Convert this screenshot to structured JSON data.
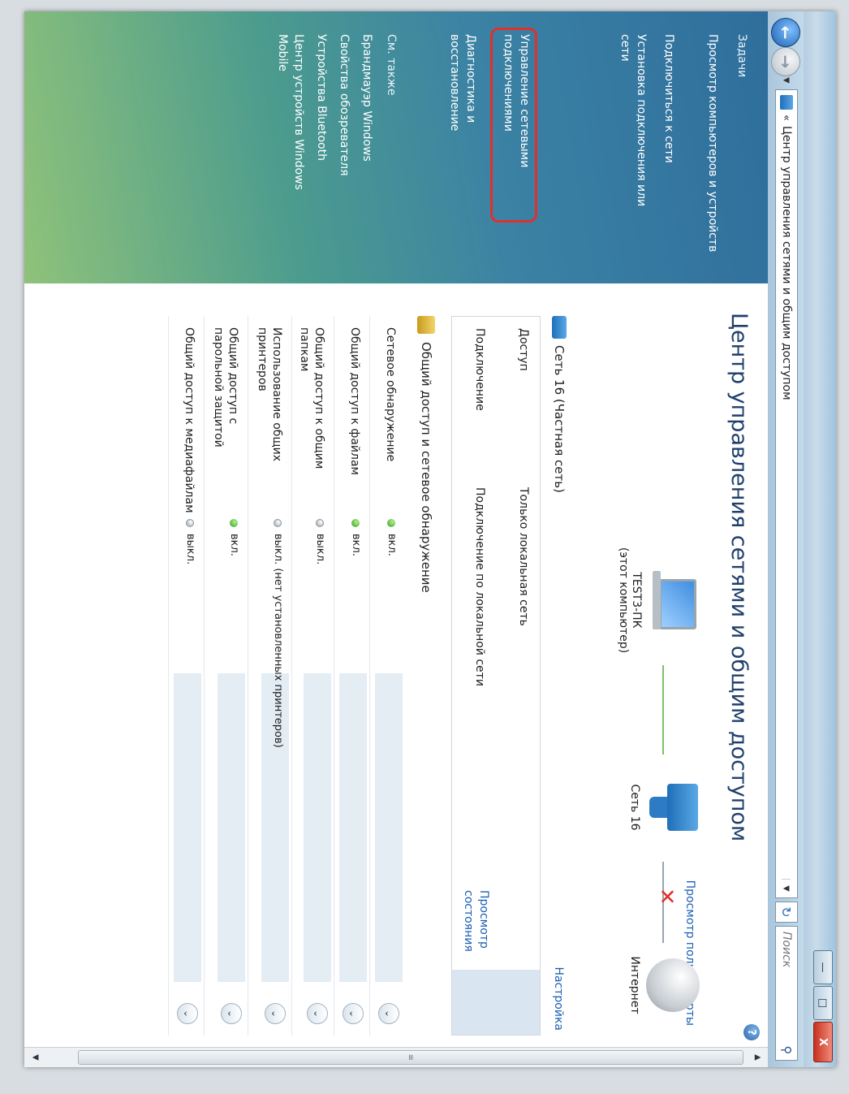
{
  "window": {
    "address_path": "Центр управления сетями и общим доступом",
    "address_chevron": "«",
    "search_placeholder": "Поиск",
    "minimize": "—",
    "maximize": "□",
    "close": "X"
  },
  "sidebar": {
    "tasks_heading": "Задачи",
    "tasks": [
      "Просмотр компьютеров и устройств",
      "Подключиться к сети",
      "Установка подключения или сети",
      "Управление сетевыми подключениями",
      "Диагностика и восстановление"
    ],
    "see_also_heading": "См. также",
    "see_also": [
      "Брандмауэр Windows",
      "Свойства обозревателя",
      "Устройства Bluetooth",
      "Центр устройств Windows Mobile"
    ]
  },
  "main": {
    "title": "Центр управления сетями и общим доступом",
    "full_map_link": "Просмотр полной карты",
    "computer_name": "TEST3-ПК",
    "computer_caption": "(этот компьютер)",
    "network_node_name": "Сеть 16",
    "internet_label": "Интернет",
    "network_heading": "Сеть 16 (Частная сеть)",
    "settings_link": "Настройка",
    "access_label": "Доступ",
    "access_value": "Только локальная сеть",
    "connection_label": "Подключение",
    "connection_value": "Подключение по локальной сети",
    "view_status_link": "Просмотр состояния",
    "sharing_heading": "Общий доступ и сетевое обнаружение",
    "sharing_rows": [
      {
        "label": "Сетевое обнаружение",
        "status": "вкл.",
        "on": true
      },
      {
        "label": "Общий доступ к файлам",
        "status": "вкл.",
        "on": true
      },
      {
        "label": "Общий доступ к общим папкам",
        "status": "выкл.",
        "on": false
      },
      {
        "label": "Использование общих принтеров",
        "status": "выкл. (нет установленных принтеров)",
        "on": false
      },
      {
        "label": "Общий доступ с парольной защитой",
        "status": "вкл.",
        "on": true
      },
      {
        "label": "Общий доступ к медиафайлам",
        "status": "выкл.",
        "on": false
      }
    ]
  },
  "colors": {
    "link": "#1a5fb4",
    "highlight_box": "#e1302c",
    "status_on": "#3a9a2a"
  }
}
